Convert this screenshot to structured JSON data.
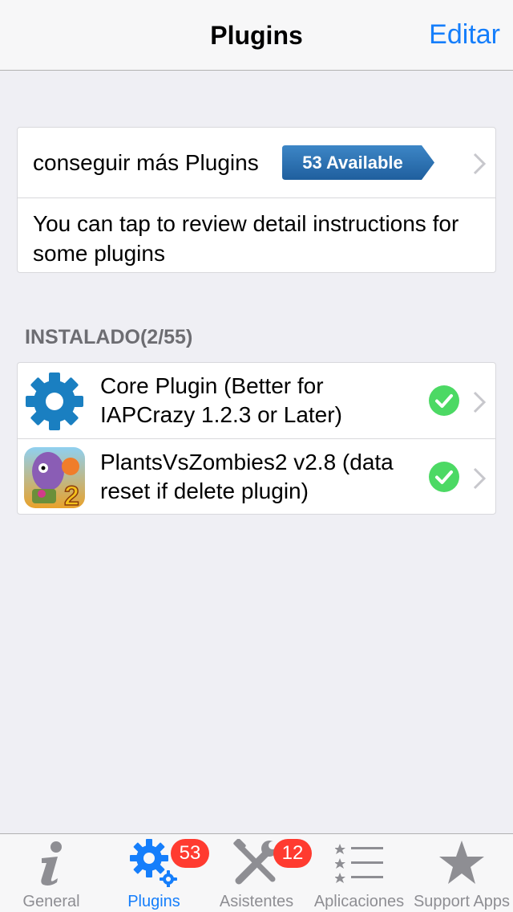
{
  "navbar": {
    "title": "Plugins",
    "edit_label": "Editar"
  },
  "get_more": {
    "label": "conseguir más Plugins",
    "badge": "53 Available"
  },
  "info": {
    "text": "You can tap to review detail instructions for some plugins"
  },
  "installed": {
    "header": "INSTALADO(2/55)",
    "items": [
      {
        "name": "Core Plugin (Better for IAPCrazy 1.2.3 or Later)",
        "icon": "gear-icon",
        "status": "checkmark-icon"
      },
      {
        "name": "PlantsVsZombies2 v2.8 (data reset if delete plugin)",
        "icon": "plants-vs-zombies-app-icon",
        "status": "checkmark-icon"
      }
    ]
  },
  "tabbar": {
    "tabs": [
      {
        "label": "General",
        "icon": "info-icon"
      },
      {
        "label": "Plugins",
        "icon": "gears-icon",
        "badge": "53",
        "active": true
      },
      {
        "label": "Asistentes",
        "icon": "tools-icon",
        "badge": "12"
      },
      {
        "label": "Aplicaciones",
        "icon": "list-stars-icon"
      },
      {
        "label": "Support Apps",
        "icon": "star-icon"
      }
    ]
  },
  "colors": {
    "accent": "#157efb",
    "badge_blue": "#2a6fb0",
    "badge_red": "#ff3b30",
    "check_green": "#4cd964"
  }
}
